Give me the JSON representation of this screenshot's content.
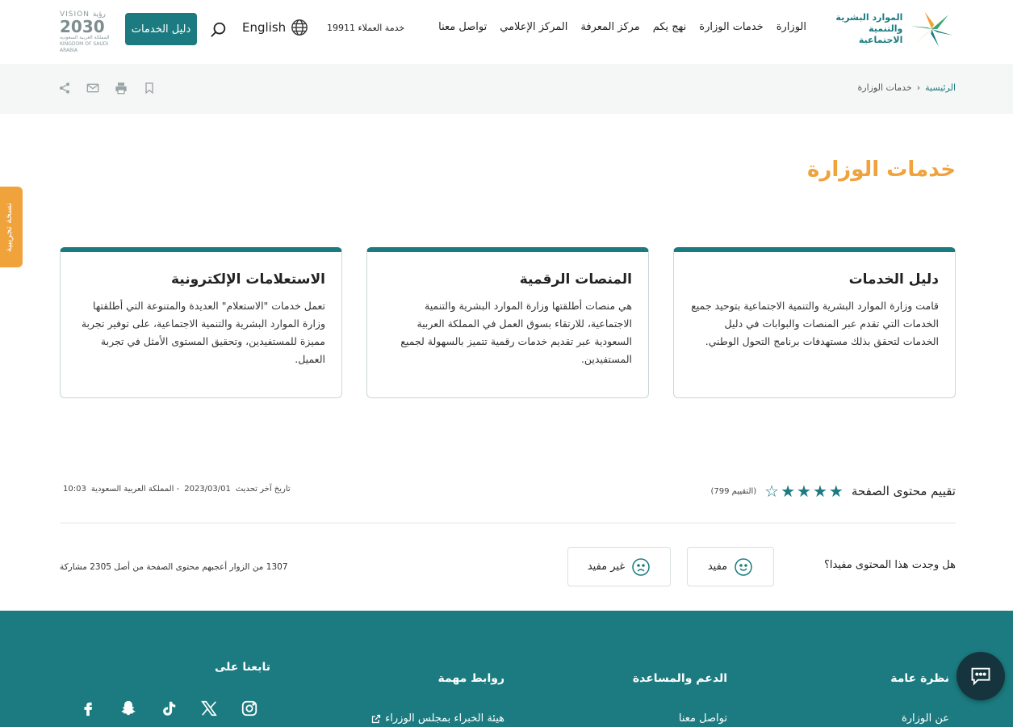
{
  "header": {
    "logo_line1": "الموارد البشرية",
    "logo_line2": "والتنمية الاجتماعية",
    "nav": [
      "الوزارة",
      "خدمات الوزارة",
      "نهج يكم",
      "مركز المعرفة",
      "المركز الإعلامي",
      "تواصل معنا"
    ],
    "hotline": "خدمة العملاء 19911",
    "language": "English",
    "guide_button": "دليل الخدمات",
    "vision_top": "VISION رؤية",
    "vision_year": "2030",
    "vision_sub1": "المملكة العربية السعودية",
    "vision_sub2": "KINGDOM OF SAUDI ARABIA"
  },
  "breadcrumb": {
    "home": "الرئيسية",
    "current": "خدمات الوزارة"
  },
  "page_title": "خدمات الوزارة",
  "beta_tab": "نسخة تجريبية",
  "cards": [
    {
      "title": "دليل الخدمات",
      "text": "قامت وزارة الموارد البشرية والتنمية الاجتماعية بتوحيد جميع الخدمات التي تقدم عبر المنصات والبوابات في دليل الخدمات لتحقق بذلك مستهدفات برنامج التحول الوطني."
    },
    {
      "title": "المنصات الرقمية",
      "text": "هي منصات أطلقتها وزارة الموارد البشرية والتنمية الاجتماعية، للارتقاء بسوق العمل في المملكة العربية السعودية عبر تقديم خدمات رقمية تتميز بالسهولة لجميع المستفيدين."
    },
    {
      "title": "الاستعلامات الإلكترونية",
      "text": "تعمل خدمات \"الاستعلام\" العديدة والمتنوعة التي أطلقتها وزارة الموارد البشرية والتنمية الاجتماعية، على توفير تجربة مميزة للمستفيدين، وتحقيق المستوى الأمثل في تجربة العميل."
    }
  ],
  "rating": {
    "label": "تقييم محتوى الصفحة",
    "count": "(التقييم 799)",
    "stars_filled": 4,
    "stars_total": 5
  },
  "updated": {
    "label": "تاريخ آخر تحديث",
    "date": "2023/03/01",
    "zone": "- المملكة العربية السعودية",
    "time": "10:03"
  },
  "feedback": {
    "question": "هل وجدت هذا المحتوى مفيدا؟",
    "useful": "مفيد",
    "not_useful": "غير مفيد",
    "stats": "1307 من الزوار أعجبهم محتوى الصفحة من أصل 2305 مشاركة"
  },
  "footer": {
    "col1_title": "نظرة عامة",
    "col1_link": "عن الوزارة",
    "col2_title": "الدعم والمساعدة",
    "col2_link": "تواصل معنا",
    "col3_title": "روابط مهمة",
    "col3_link": "هيئة الخبراء بمجلس الوزراء",
    "follow": "تابعنا على",
    "socials": [
      "instagram-icon",
      "x-icon",
      "tiktok-icon",
      "snapchat-icon",
      "facebook-icon"
    ]
  },
  "colors": {
    "primary": "#1b7b80",
    "accent": "#f0a23b",
    "chat": "#16343d"
  }
}
